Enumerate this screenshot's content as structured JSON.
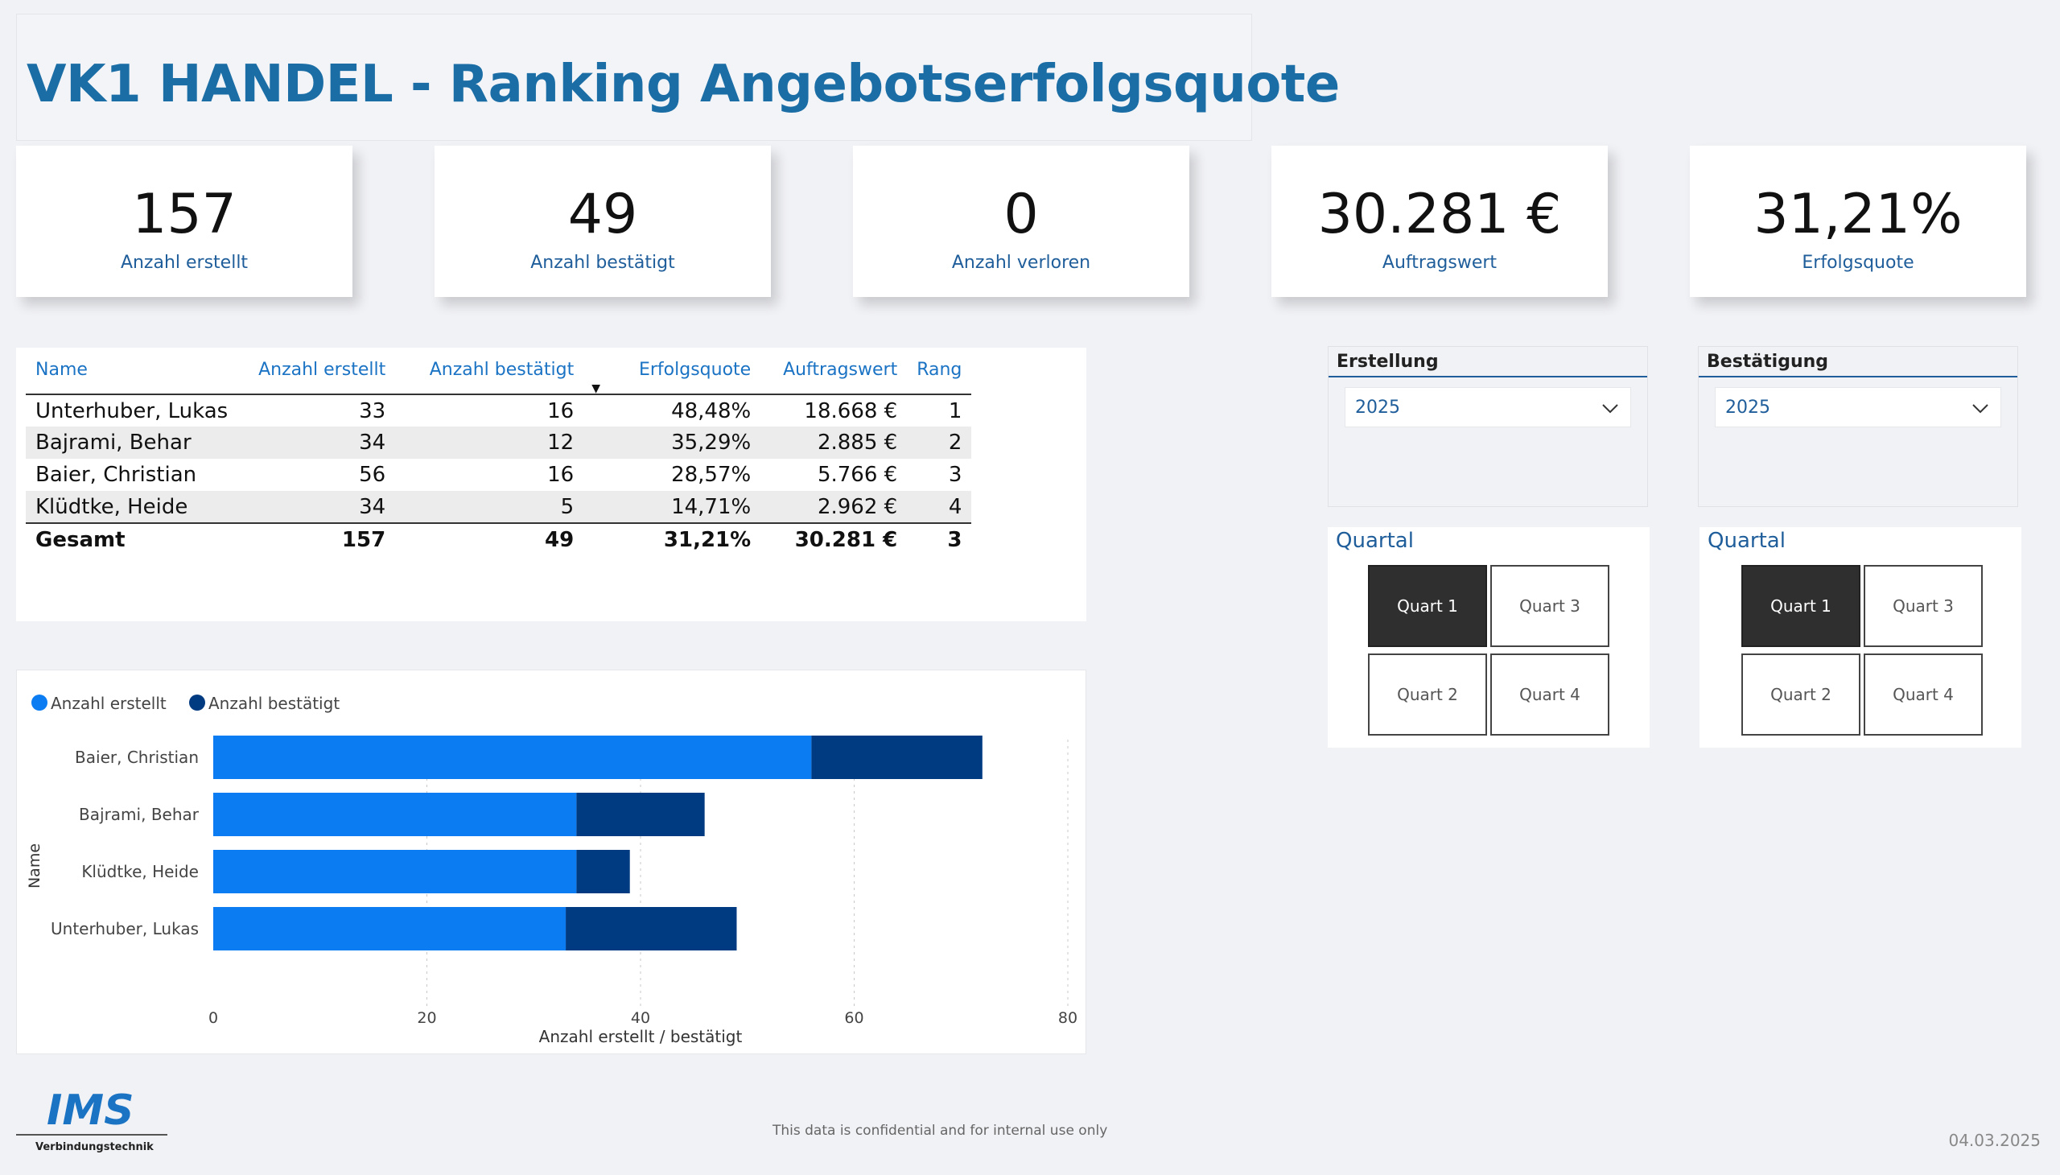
{
  "title": "VK1 HANDEL - Ranking Angebotserfolgsquote",
  "kpis": [
    {
      "value": "157",
      "label": "Anzahl erstellt"
    },
    {
      "value": "49",
      "label": "Anzahl bestätigt"
    },
    {
      "value": "0",
      "label": "Anzahl verloren"
    },
    {
      "value": "30.281 €",
      "label": "Auftragswert"
    },
    {
      "value": "31,21%",
      "label": "Erfolgsquote"
    }
  ],
  "table": {
    "headers": [
      "Name",
      "Anzahl erstellt",
      "Anzahl bestätigt",
      "Erfolgsquote",
      "Auftragswert",
      "Rang"
    ],
    "rows": [
      [
        "Unterhuber, Lukas",
        "33",
        "16",
        "48,48%",
        "18.668 €",
        "1"
      ],
      [
        "Bajrami, Behar",
        "34",
        "12",
        "35,29%",
        "2.885 €",
        "2"
      ],
      [
        "Baier, Christian",
        "56",
        "16",
        "28,57%",
        "5.766 €",
        "3"
      ],
      [
        "Klüdtke, Heide",
        "34",
        "5",
        "14,71%",
        "2.962 €",
        "4"
      ]
    ],
    "total": [
      "Gesamt",
      "157",
      "49",
      "31,21%",
      "30.281 €",
      "3"
    ]
  },
  "slicers": [
    {
      "title": "Erstellung",
      "value": "2025"
    },
    {
      "title": "Bestätigung",
      "value": "2025"
    }
  ],
  "quarter_panels": [
    {
      "title": "Quartal",
      "buttons": [
        "Quart 1",
        "Quart 3",
        "Quart 2",
        "Quart 4"
      ],
      "selected": "Quart 1"
    },
    {
      "title": "Quartal",
      "buttons": [
        "Quart 1",
        "Quart 3",
        "Quart 2",
        "Quart 4"
      ],
      "selected": "Quart 1"
    }
  ],
  "chart_data": {
    "type": "bar",
    "orientation": "horizontal",
    "stacked": true,
    "categories": [
      "Baier, Christian",
      "Bajrami, Behar",
      "Klüdtke, Heide",
      "Unterhuber, Lukas"
    ],
    "series": [
      {
        "name": "Anzahl erstellt",
        "values": [
          56,
          34,
          34,
          33
        ],
        "color": "#0b7cf2"
      },
      {
        "name": "Anzahl bestätigt",
        "values": [
          16,
          12,
          5,
          16
        ],
        "color": "#003a80"
      }
    ],
    "xlabel": "Anzahl erstellt / bestätigt",
    "ylabel": "Name",
    "xlim": [
      0,
      80
    ],
    "xticks": [
      0,
      20,
      40,
      60,
      80
    ],
    "grid": true,
    "legend": "top-left"
  },
  "footer": {
    "logo_text": "IMS",
    "logo_subtext": "Verbindungstechnik",
    "confidential": "This data is confidential and for internal use only",
    "date": "04.03.2025"
  }
}
